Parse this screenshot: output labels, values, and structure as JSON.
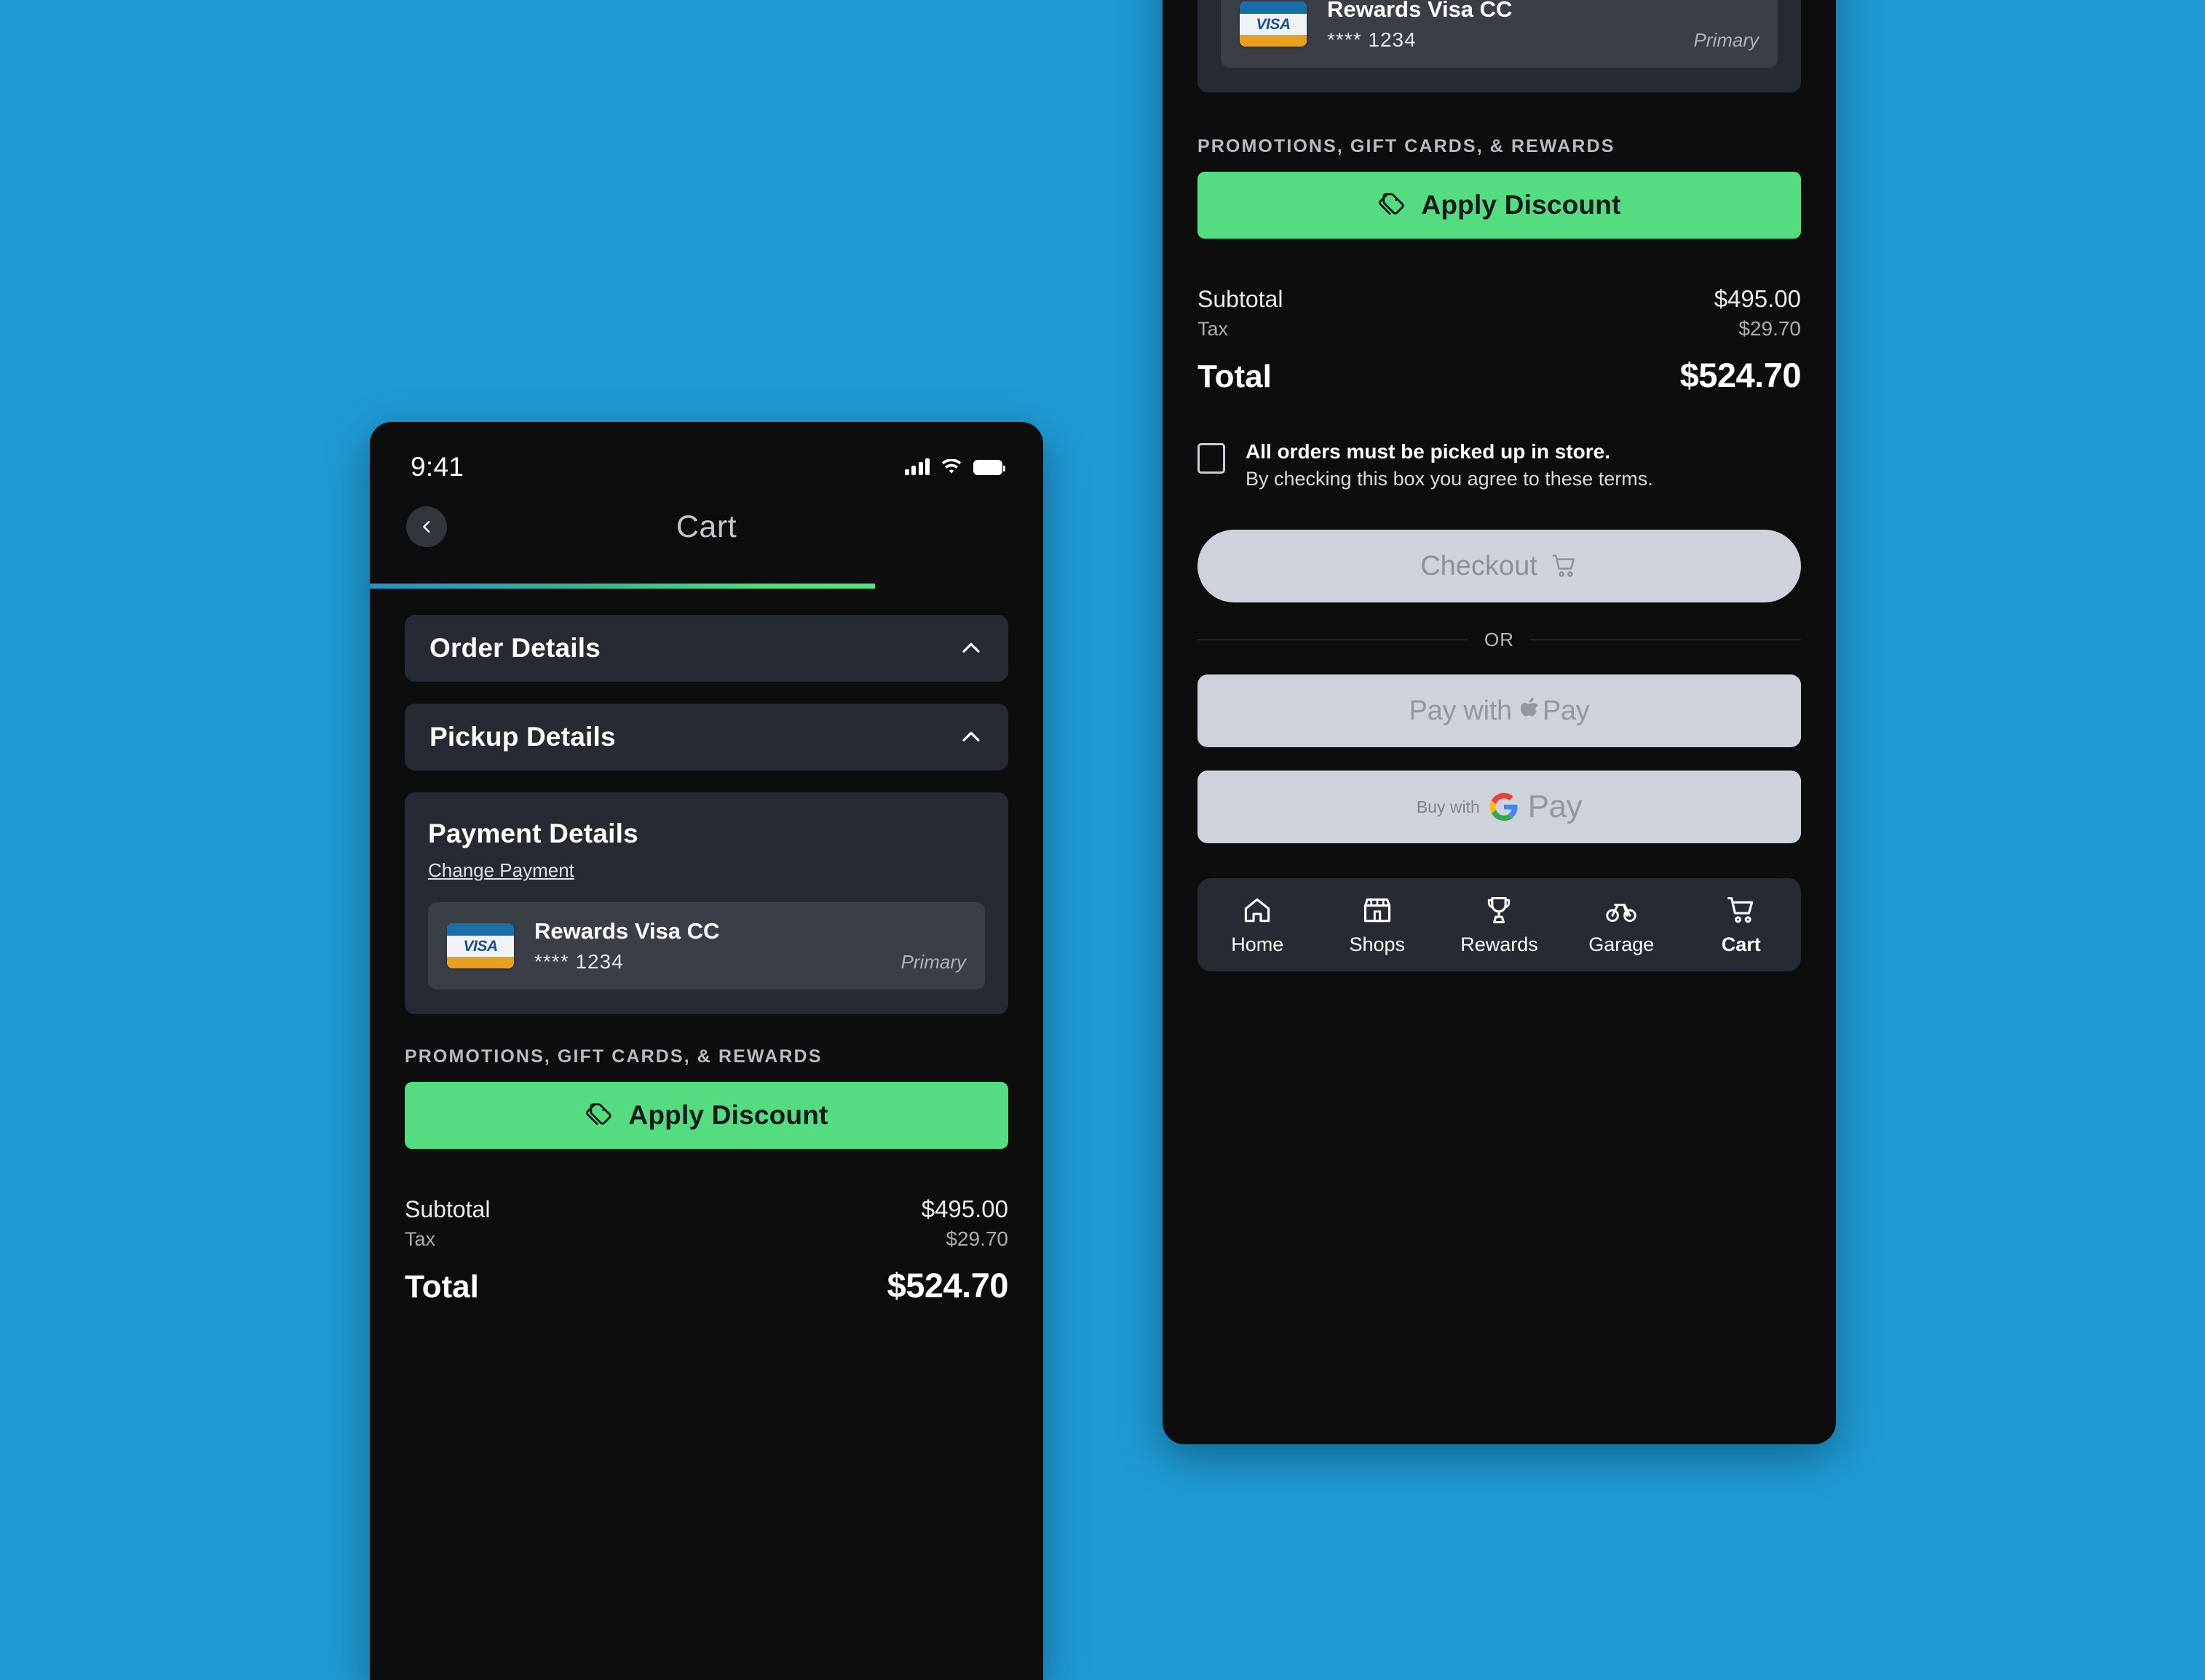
{
  "background_color": "#1f9bd4",
  "theme": {
    "screen_bg": "#0d0d0d",
    "card_bg": "#262b33",
    "accent_green": "#55dc80",
    "button_gray": "#ced2da",
    "muted_text": "#a9aeb4"
  },
  "status_bar": {
    "time": "9:41",
    "signal_icon": "cellular-bars-icon",
    "wifi_icon": "wifi-icon",
    "battery_icon": "battery-icon"
  },
  "header": {
    "title": "Cart",
    "back_icon": "chevron-left-icon",
    "progress_percent": 75
  },
  "accordions": [
    {
      "label": "Order Details",
      "icon": "chevron-up-icon",
      "expanded": true
    },
    {
      "label": "Pickup Details",
      "icon": "chevron-up-icon",
      "expanded": true
    }
  ],
  "payment": {
    "title": "Payment Details",
    "change_link": "Change Payment",
    "card": {
      "brand_logo": "visa-logo",
      "brand_text": "VISA",
      "name": "Rewards Visa CC",
      "masked_number": "**** 1234",
      "badge": "Primary"
    }
  },
  "promotions": {
    "section_label": "PROMOTIONS, GIFT CARDS, & REWARDS",
    "apply_button": "Apply Discount",
    "apply_icon": "price-tags-icon"
  },
  "totals": {
    "subtotal_label": "Subtotal",
    "subtotal_value": "$495.00",
    "tax_label": "Tax",
    "tax_value": "$29.70",
    "total_label": "Total",
    "total_value": "$524.70"
  },
  "terms": {
    "checked": false,
    "line1": "All orders must be picked up in store.",
    "line2": "By checking this box you agree to these terms."
  },
  "checkout": {
    "label": "Checkout",
    "icon": "shopping-cart-icon",
    "disabled": true,
    "or_divider": "OR",
    "apple_pay_prefix": "Pay with",
    "apple_pay_suffix": "Pay",
    "apple_icon": "apple-logo-icon",
    "google_pay_prefix": "Buy with",
    "google_pay_suffix": "Pay",
    "google_icon": "google-g-icon"
  },
  "tabbar": {
    "items": [
      {
        "label": "Home",
        "icon": "home-icon",
        "active": false
      },
      {
        "label": "Shops",
        "icon": "storefront-icon",
        "active": false
      },
      {
        "label": "Rewards",
        "icon": "trophy-icon",
        "active": false
      },
      {
        "label": "Garage",
        "icon": "bicycle-icon",
        "active": false
      },
      {
        "label": "Cart",
        "icon": "shopping-cart-icon",
        "active": true
      }
    ]
  }
}
